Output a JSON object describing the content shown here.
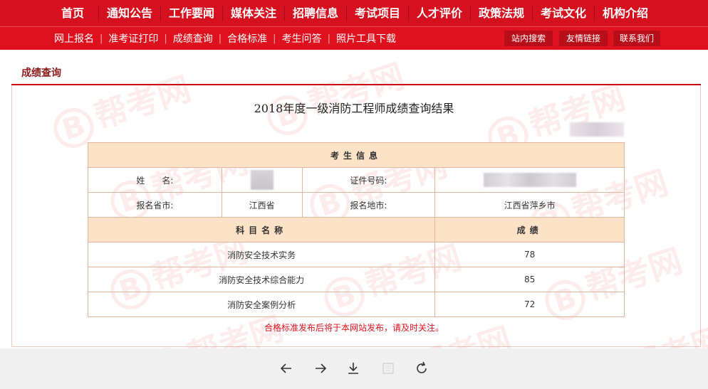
{
  "topnav": {
    "items": [
      "首页",
      "通知公告",
      "工作要闻",
      "媒体关注",
      "招聘信息",
      "考试项目",
      "人才评价",
      "政策法规",
      "考试文化",
      "机构介绍"
    ]
  },
  "subnav": {
    "links": [
      "网上报名",
      "准考证打印",
      "成绩查询",
      "合格标准",
      "考生问答",
      "照片工具下载"
    ],
    "separator": "|",
    "buttons": [
      "站内搜索",
      "友情链接",
      "联系我们"
    ]
  },
  "breadcrumb": "成绩查询",
  "page": {
    "title": "2018年度一级消防工程师成绩查询结果",
    "notice": "合格标准发布后将于本网站发布，请及时关注。"
  },
  "table": {
    "section_header": "考生信息",
    "name_label": "姓　　名:",
    "id_label": "证件号码:",
    "province_label": "报名省市:",
    "province_value": "江西省",
    "location_label": "报名地市:",
    "location_value": "江西省萍乡市",
    "subject_header": "科目名称",
    "score_header": "成绩",
    "rows": [
      {
        "subject": "消防安全技术实务",
        "score": "78"
      },
      {
        "subject": "消防安全技术综合能力",
        "score": "85"
      },
      {
        "subject": "消防安全案例分析",
        "score": "72"
      }
    ]
  },
  "watermark": {
    "letter": "B",
    "text": "帮考网"
  },
  "toolbar": {
    "icons": [
      "arrow-left-icon",
      "arrow-right-icon",
      "download-icon",
      "page-icon",
      "refresh-icon"
    ]
  },
  "colors": {
    "nav_red": "#d5101f",
    "header_bg": "#fce3c7",
    "notice_red": "#e0111e"
  }
}
